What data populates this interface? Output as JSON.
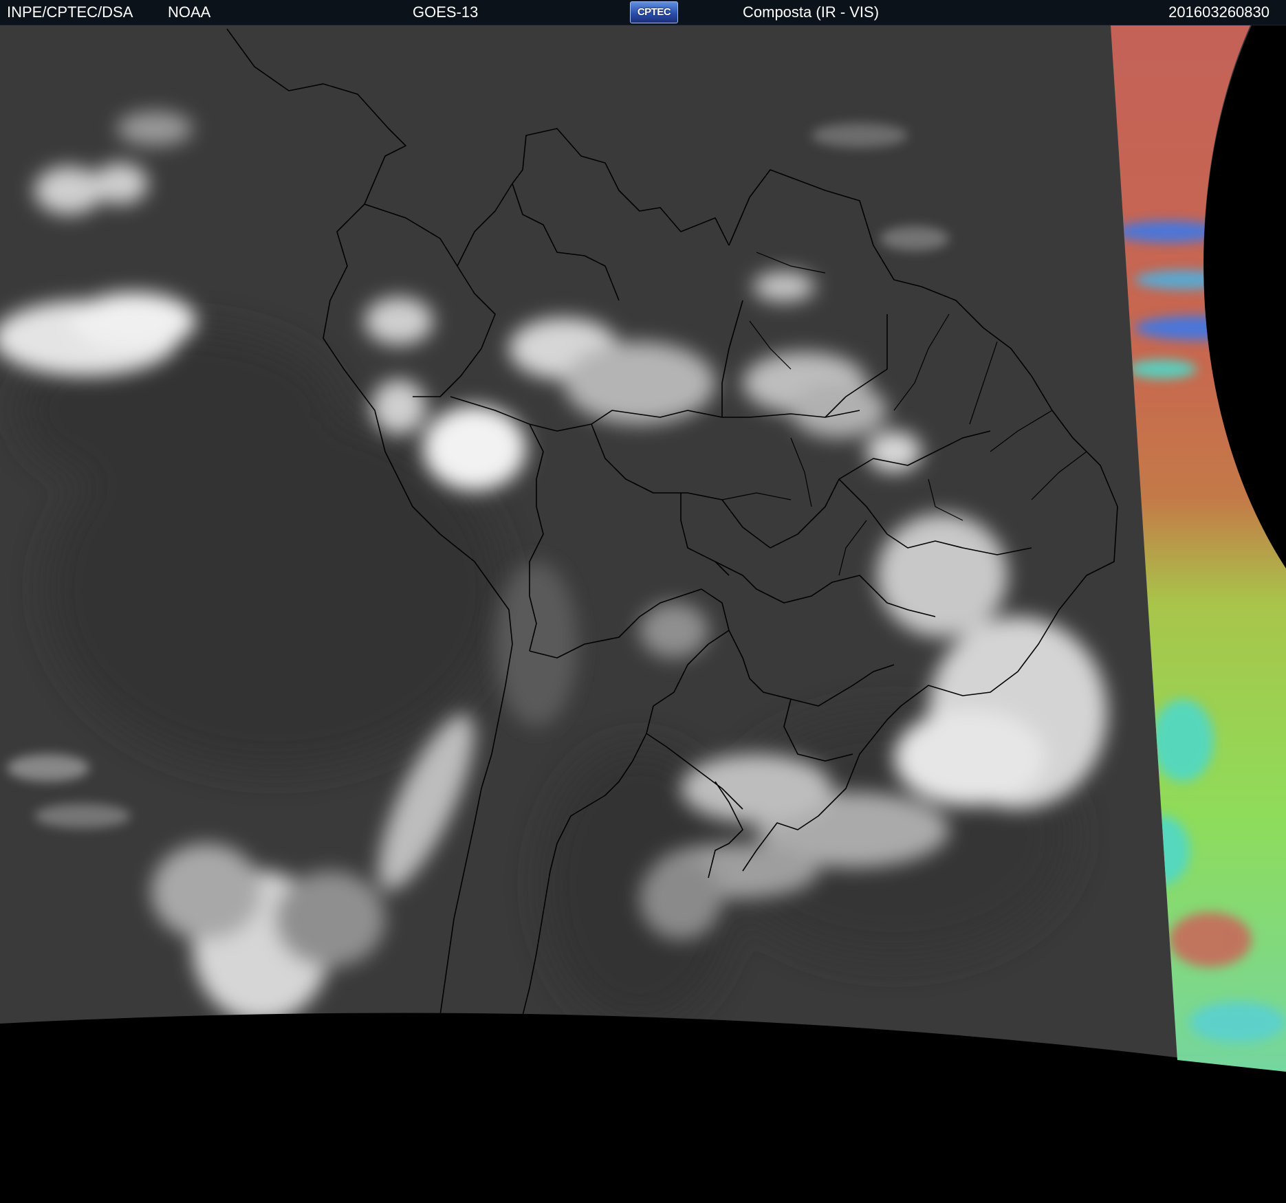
{
  "header": {
    "institution": "INPE/CPTEC/DSA",
    "agency": "NOAA",
    "satellite": "GOES-13",
    "logo_text": "CPTEC",
    "product": "Composta (IR - VIS)",
    "timestamp": "201603260830"
  },
  "colors": {
    "background": "#000000",
    "header_bar": "#0c1219",
    "ir_base": "#3a3a3a",
    "cloud": "#e6e6e6",
    "borders": "#000000",
    "vis_red": "#c9605a",
    "vis_green": "#9ad84a",
    "vis_cyan": "#50d8c8",
    "vis_blue": "#3c78e8"
  },
  "icons": [
    "cptec-logo-icon"
  ]
}
